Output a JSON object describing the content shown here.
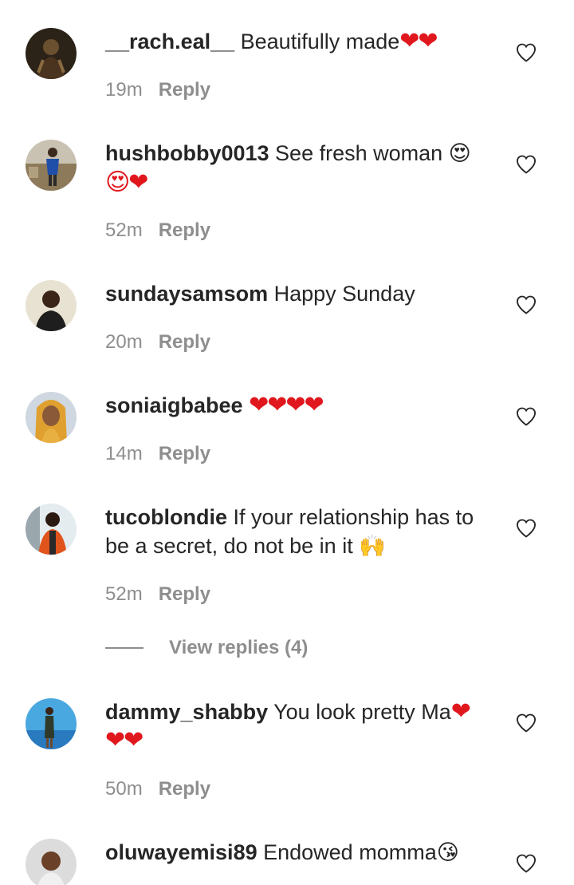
{
  "comments": [
    {
      "username": "__rach.eal__",
      "text": " Beautifully made",
      "emoji": "❤❤",
      "text2": "",
      "emoji2": "",
      "time": "19m",
      "reply": "Reply"
    },
    {
      "username": "hushbobby0013",
      "text": " See fresh woman ",
      "emoji": "😍",
      "text2": "",
      "emoji2": "😍❤",
      "time": "52m",
      "reply": "Reply"
    },
    {
      "username": "sundaysamsom",
      "text": " Happy Sunday",
      "emoji": "",
      "text2": "",
      "emoji2": "",
      "time": "20m",
      "reply": "Reply"
    },
    {
      "username": "soniaigbabee",
      "text": " ",
      "emoji": "❤❤❤❤",
      "text2": "",
      "emoji2": "",
      "time": "14m",
      "reply": "Reply"
    },
    {
      "username": "tucoblondie",
      "text": " If your relationship has to be a secret, do not be in it ",
      "emoji": "🙌",
      "text2": "",
      "emoji2": "",
      "time": "52m",
      "reply": "Reply"
    },
    {
      "username": "dammy_shabby",
      "text": " You look pretty Ma",
      "emoji": "❤",
      "text2": "",
      "emoji2": "❤❤",
      "time": "50m",
      "reply": "Reply"
    },
    {
      "username": "oluwayemisi89",
      "text": " Endowed momma",
      "emoji": "😘",
      "text2": "",
      "emoji2": "",
      "time": "",
      "reply": ""
    }
  ],
  "view_replies": "View replies (4)",
  "icons": {
    "like": "heart-outline-icon"
  },
  "colors": {
    "text": "#262626",
    "meta": "#8e8e8e",
    "heart": "#e0181e"
  }
}
